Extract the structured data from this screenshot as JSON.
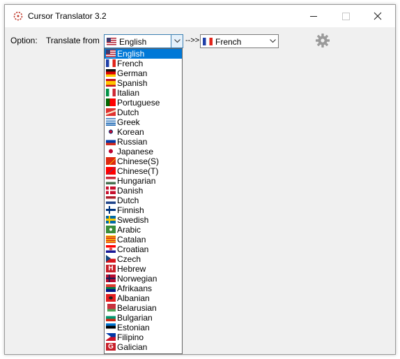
{
  "window": {
    "title": "Cursor Translator 3.2"
  },
  "toolbar": {
    "option_label": "Option:",
    "translate_from_label": "Translate from",
    "from_value": "English",
    "arrow_label": "-->>",
    "to_value": "French",
    "icons": {
      "settings": "gear-icon",
      "dropdown": "chevron-down-icon"
    }
  },
  "dropdown": {
    "selected": "English",
    "items": [
      {
        "label": "English",
        "flag": "us"
      },
      {
        "label": "French",
        "flag": "fr"
      },
      {
        "label": "German",
        "flag": "de"
      },
      {
        "label": "Spanish",
        "flag": "es"
      },
      {
        "label": "Italian",
        "flag": "it"
      },
      {
        "label": "Portuguese",
        "flag": "pt"
      },
      {
        "label": "Dutch",
        "flag": "nl-swoosh"
      },
      {
        "label": "Greek",
        "flag": "gr"
      },
      {
        "label": "Korean",
        "flag": "kr"
      },
      {
        "label": "Russian",
        "flag": "ru"
      },
      {
        "label": "Japanese",
        "flag": "jp"
      },
      {
        "label": "Chinese(S)",
        "flag": "cn"
      },
      {
        "label": "Chinese(T)",
        "flag": "tw"
      },
      {
        "label": "Hungarian",
        "flag": "hu"
      },
      {
        "label": "Danish",
        "flag": "dk"
      },
      {
        "label": "Dutch",
        "flag": "nl"
      },
      {
        "label": "Finnish",
        "flag": "fi"
      },
      {
        "label": "Swedish",
        "flag": "se"
      },
      {
        "label": "Arabic",
        "flag": "ar"
      },
      {
        "label": "Catalan",
        "flag": "ca"
      },
      {
        "label": "Croatian",
        "flag": "hr"
      },
      {
        "label": "Czech",
        "flag": "cz"
      },
      {
        "label": "Hebrew",
        "flag": "he"
      },
      {
        "label": "Norwegian",
        "flag": "no"
      },
      {
        "label": "Afrikaans",
        "flag": "za"
      },
      {
        "label": "Albanian",
        "flag": "al"
      },
      {
        "label": "Belarusian",
        "flag": "by"
      },
      {
        "label": "Bulgarian",
        "flag": "bg"
      },
      {
        "label": "Estonian",
        "flag": "ee"
      },
      {
        "label": "Filipino",
        "flag": "ph"
      },
      {
        "label": "Galician",
        "flag": "gl"
      }
    ]
  },
  "colors": {
    "selection": "#0078d7",
    "window_bg": "#f0f0f0",
    "focus_border": "#3c7fb1"
  }
}
